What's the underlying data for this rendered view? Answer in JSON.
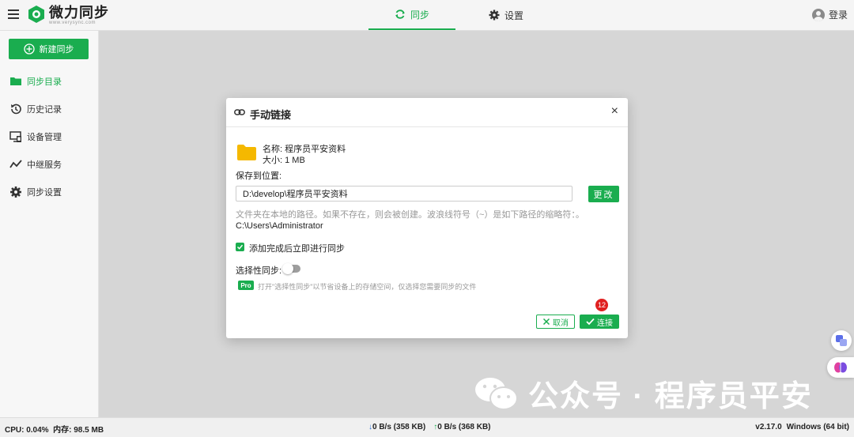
{
  "header": {
    "app_name": "微力同步",
    "app_domain": "www.verysync.com",
    "tabs": [
      {
        "label": "同步",
        "icon": "sync-icon",
        "active": true
      },
      {
        "label": "设置",
        "icon": "gear-icon",
        "active": false
      }
    ],
    "login_label": "登录"
  },
  "sidebar": {
    "new_sync_label": "新建同步",
    "items": [
      {
        "label": "同步目录",
        "icon": "folder-icon",
        "active": true
      },
      {
        "label": "历史记录",
        "icon": "history-icon",
        "active": false
      },
      {
        "label": "设备管理",
        "icon": "device-icon",
        "active": false
      },
      {
        "label": "中继服务",
        "icon": "relay-icon",
        "active": false
      },
      {
        "label": "同步设置",
        "icon": "gear-icon",
        "active": false
      }
    ]
  },
  "dialog": {
    "title": "手动链接",
    "file_name": "名称: 程序员平安资料",
    "file_size": "大小: 1 MB",
    "save_label": "保存到位置:",
    "path_value": "D:\\develop\\程序员平安资料",
    "change_label": "更改",
    "hint": "文件夹在本地的路径。如果不存在，则会被创建。波浪线符号（~）是如下路径的缩略符：。",
    "home_path": "C:\\Users\\Administrator",
    "sync_after_add_label": "添加完成后立即进行同步",
    "sync_after_add_checked": true,
    "selective_label": "选择性同步:",
    "selective_enabled": false,
    "pro_badge": "Pro",
    "pro_hint": "打开\"选择性同步\"以节省设备上的存储空间，仅选择您需要同步的文件",
    "badge_count": "12",
    "cancel_label": "取消",
    "connect_label": "连接"
  },
  "status": {
    "cpu": "CPU: 0.04%",
    "memory": "内存: 98.5 MB",
    "download": "0 B/s (358 KB)",
    "upload": "0 B/s (368 KB)",
    "version": "v2.17.0",
    "os": "Windows (64 bit)"
  },
  "watermark": {
    "text": "公众号 · 程序员平安"
  },
  "colors": {
    "accent": "#1aad4f",
    "badge": "#e02020",
    "download_arrow": "#2a6fd6"
  }
}
